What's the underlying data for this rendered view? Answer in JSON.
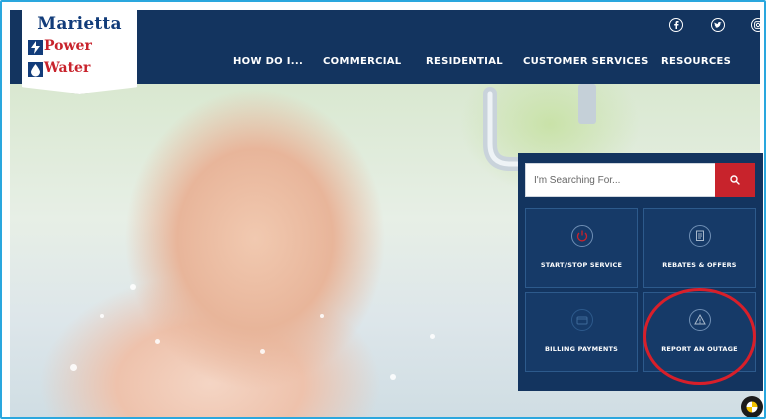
{
  "brand": {
    "name_line1": "Marietta",
    "name_line2": "Power",
    "name_line3": "Water",
    "color_navy": "#13345f",
    "color_red": "#c8232c"
  },
  "nav": {
    "items": [
      {
        "label": "HOW DO I..."
      },
      {
        "label": "COMMERCIAL"
      },
      {
        "label": "RESIDENTIAL"
      },
      {
        "label": "CUSTOMER SERVICES"
      },
      {
        "label": "RESOURCES"
      }
    ]
  },
  "social": {
    "icons": [
      "facebook-icon",
      "twitter-icon",
      "instagram-icon"
    ]
  },
  "search": {
    "placeholder": "I'm Searching For..."
  },
  "quick_links": [
    {
      "label": "START/STOP SERVICE",
      "icon": "power-icon"
    },
    {
      "label": "REBATES & OFFERS",
      "icon": "document-icon"
    },
    {
      "label": "BILLING PAYMENTS",
      "icon": "payment-icon"
    },
    {
      "label": "REPORT AN OUTAGE",
      "icon": "alert-icon"
    }
  ],
  "highlight_color": "#d81f2a"
}
